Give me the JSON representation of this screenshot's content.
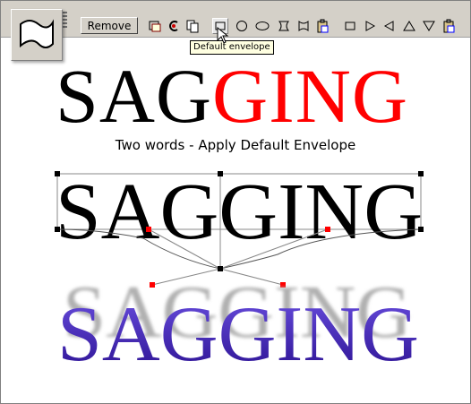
{
  "toolbar": {
    "remove_label": "Remove",
    "tooltip": "Default envelope",
    "icons": [
      "tool-flag-icon",
      "copy-envelope-icon",
      "paste-envelope-icon",
      "clear-envelope-icon",
      "default-envelope-icon",
      "circle-envelope-icon",
      "ellipse-envelope-icon",
      "hourglass-envelope-icon",
      "bowtie-envelope-icon",
      "paste-shape-icon",
      "square-icon",
      "triangle-right-icon",
      "triangle-left-icon",
      "triangle-up-icon",
      "triangle-down-icon",
      "clipboard-icon"
    ]
  },
  "title": {
    "part1": "SAG",
    "part2": "GING"
  },
  "caption": "Two words - Apply Default Envelope",
  "envelope_text": "SAGGING",
  "result_text": "SAGGING",
  "colors": {
    "red": "#ff0000",
    "blue": "#3b1fb8",
    "toolbar": "#d4d0c8",
    "tooltip": "#ffffe1"
  }
}
